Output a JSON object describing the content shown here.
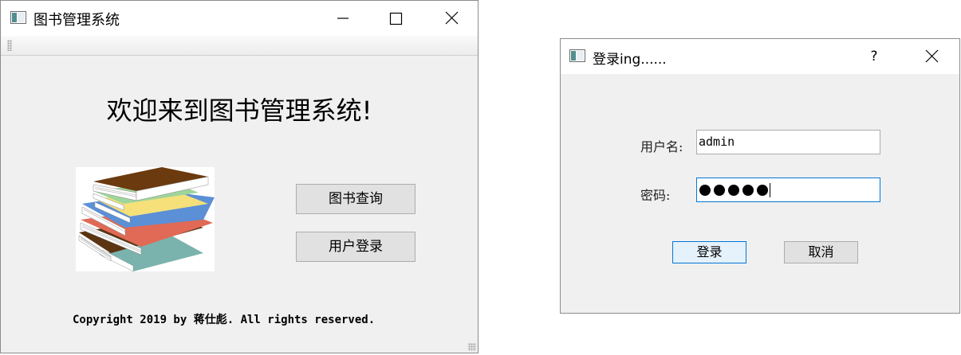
{
  "main_window": {
    "title": "图书管理系统",
    "welcome_text": "欢迎来到图书管理系统!",
    "buttons": {
      "book_search": "图书查询",
      "user_login": "用户登录"
    },
    "copyright": "Copyright 2019 by 蒋仕彪. All rights reserved.",
    "icons": [
      "app-window-icon",
      "minimize-icon",
      "maximize-icon",
      "close-icon",
      "books-stack-image"
    ]
  },
  "login_dialog": {
    "title": "登录ing......",
    "help_label": "?",
    "username_label": "用户名:",
    "username_value": "admin",
    "password_label": "密码:",
    "password_masked": "●●●●●",
    "buttons": {
      "login": "登录",
      "cancel": "取消"
    },
    "icons": [
      "app-window-icon",
      "close-icon"
    ]
  },
  "colors": {
    "window_bg": "#f0f0f0",
    "button_bg": "#e1e1e1",
    "focus_accent": "#0078d7"
  }
}
